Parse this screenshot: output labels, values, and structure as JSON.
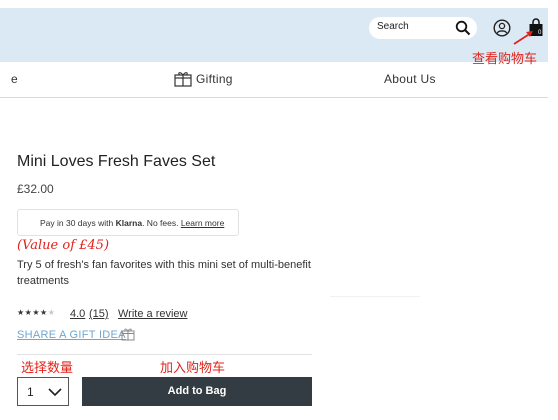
{
  "header": {
    "search_placeholder": "Search",
    "icons": {
      "search": "search-icon",
      "account": "account-icon",
      "bag": "shopping-bag-icon"
    },
    "annotation_view_cart": "查看购物车"
  },
  "nav": {
    "items": [
      {
        "label": "e"
      },
      {
        "label": "Gifting",
        "icon": "gift-icon"
      },
      {
        "label": "About Us"
      }
    ]
  },
  "product": {
    "title": "Mini Loves Fresh Faves Set",
    "price": "£32.00",
    "klarna": {
      "prefix": "Pay in 30 days with ",
      "brand": "Klarna",
      "suffix": ". No fees. ",
      "link": "Learn more"
    },
    "value_annotation": "(Value of £45)",
    "description": "Try 5 of fresh's fan favorites with this mini set of multi-benefit treatments",
    "rating_stars": 4.0,
    "stars_glyphs": "★★★★★",
    "rating": "4.0",
    "review_count": "(15)",
    "write_review": "Write a review",
    "share": "SHARE A GIFT IDEA",
    "annotation_select_qty": "选择数量",
    "annotation_add_to_cart": "加入购物车",
    "quantity": "1",
    "add_to_bag": "Add to Bag"
  },
  "colors": {
    "banner": "#dbe9f5",
    "annotation": "#e0241b",
    "share_link": "#6fa6cf",
    "button": "#323c42"
  }
}
